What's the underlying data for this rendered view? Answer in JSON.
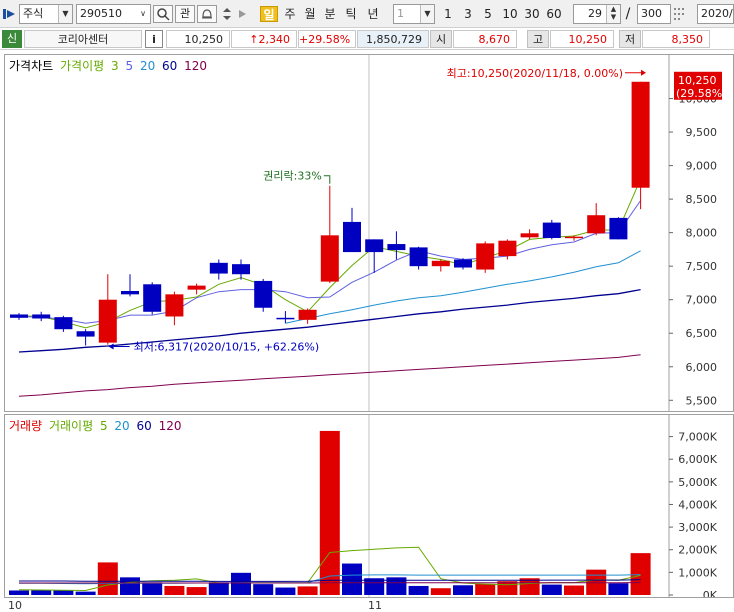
{
  "toolbar": {
    "menu_icon": "menu-arrow-icon",
    "market_type": "주식",
    "stock_code": "290510",
    "search_icon": "magnifier-icon",
    "watch_label": "관",
    "period_buttons": [
      {
        "label": "일",
        "selected": true
      },
      {
        "label": "주",
        "selected": false
      },
      {
        "label": "월",
        "selected": false
      },
      {
        "label": "분",
        "selected": false
      },
      {
        "label": "틱",
        "selected": false
      },
      {
        "label": "년",
        "selected": false
      }
    ],
    "interval_value": "1",
    "interval_buttons": [
      "1",
      "3",
      "5",
      "10",
      "30",
      "60"
    ],
    "view_count": "29",
    "total_count": "300",
    "date_field": "2020/"
  },
  "quote": {
    "badge": "신",
    "name": "코리아센터",
    "info_button": "i",
    "price": "10,250",
    "change": "↑2,340",
    "change_rate": "+29.58%",
    "volume": "1,850,729",
    "open_label": "시",
    "open": "8,670",
    "high_label": "고",
    "high": "10,250",
    "low_label": "저",
    "low": "8,350"
  },
  "colors": {
    "up": "#e00000",
    "down": "#0000c0",
    "ma3": "#66aa00",
    "ma5": "#6060e0",
    "ma20": "#2090d0",
    "ma60": "#000090",
    "ma120": "#800050"
  },
  "price_legend": {
    "title": "가격차트",
    "ma_title": "가격이평",
    "ma_periods": [
      "3",
      "5",
      "20",
      "60",
      "120"
    ]
  },
  "volume_legend": {
    "title": "거래량",
    "ma_title": "거래이평",
    "ma_periods": [
      "5",
      "20",
      "60",
      "120"
    ]
  },
  "annotations": {
    "high": "최고:10,250(2020/11/18, 0.00%)",
    "low": "최저:6,317(2020/10/15, +62.26%)",
    "rights": "권리락:33%",
    "last_price": "10,250",
    "last_rate": "(29.58%)"
  },
  "chart_data": [
    {
      "type": "candlestick",
      "y_ticks": [
        "10,000",
        "9,500",
        "9,000",
        "8,500",
        "8,000",
        "7,500",
        "7,000",
        "6,500",
        "6,000",
        "5,500"
      ],
      "y_tick_values": [
        10000,
        9500,
        9000,
        8500,
        8000,
        7500,
        7000,
        6500,
        6000,
        5500
      ],
      "ylim": [
        5400,
        10500
      ],
      "x_labels": [
        {
          "label": "10",
          "index": 0
        },
        {
          "label": "11",
          "index": 16
        }
      ],
      "candles": [
        {
          "o": 6780,
          "h": 6800,
          "l": 6700,
          "c": 6730
        },
        {
          "o": 6780,
          "h": 6820,
          "l": 6680,
          "c": 6720
        },
        {
          "o": 6740,
          "h": 6760,
          "l": 6520,
          "c": 6560
        },
        {
          "o": 6530,
          "h": 6560,
          "l": 6317,
          "c": 6450
        },
        {
          "o": 6360,
          "h": 7380,
          "l": 6330,
          "c": 7000
        },
        {
          "o": 7130,
          "h": 7380,
          "l": 7050,
          "c": 7080
        },
        {
          "o": 7230,
          "h": 7260,
          "l": 6780,
          "c": 6820
        },
        {
          "o": 6750,
          "h": 7120,
          "l": 6620,
          "c": 7080
        },
        {
          "o": 7150,
          "h": 7240,
          "l": 7080,
          "c": 7210
        },
        {
          "o": 7550,
          "h": 7600,
          "l": 7300,
          "c": 7390
        },
        {
          "o": 7530,
          "h": 7600,
          "l": 7300,
          "c": 7380
        },
        {
          "o": 7280,
          "h": 7310,
          "l": 6820,
          "c": 6880
        },
        {
          "o": 6730,
          "h": 6830,
          "l": 6650,
          "c": 6720
        },
        {
          "o": 6700,
          "h": 6870,
          "l": 6640,
          "c": 6850
        },
        {
          "o": 7270,
          "h": 8700,
          "l": 7250,
          "c": 7960
        },
        {
          "o": 8160,
          "h": 8370,
          "l": 7720,
          "c": 7710
        },
        {
          "o": 7900,
          "h": 7900,
          "l": 7400,
          "c": 7710
        },
        {
          "o": 7830,
          "h": 8020,
          "l": 7600,
          "c": 7740
        },
        {
          "o": 7780,
          "h": 7790,
          "l": 7450,
          "c": 7500
        },
        {
          "o": 7500,
          "h": 7600,
          "l": 7420,
          "c": 7580
        },
        {
          "o": 7600,
          "h": 7620,
          "l": 7450,
          "c": 7480
        },
        {
          "o": 7450,
          "h": 7870,
          "l": 7400,
          "c": 7840
        },
        {
          "o": 7650,
          "h": 7900,
          "l": 7600,
          "c": 7880
        },
        {
          "o": 7930,
          "h": 8050,
          "l": 7900,
          "c": 7990
        },
        {
          "o": 8150,
          "h": 8190,
          "l": 7900,
          "c": 7920
        },
        {
          "o": 7920,
          "h": 7960,
          "l": 7880,
          "c": 7940
        },
        {
          "o": 7990,
          "h": 8440,
          "l": 7960,
          "c": 8260
        },
        {
          "o": 8220,
          "h": 8230,
          "l": 7900,
          "c": 7900
        },
        {
          "o": 8670,
          "h": 10250,
          "l": 8350,
          "c": 10250
        }
      ],
      "ma_lines": [
        {
          "name": "3",
          "values": [
            6760,
            6750,
            6670,
            6580,
            6670,
            6840,
            6970,
            6990,
            7040,
            7230,
            7330,
            7220,
            7000,
            6820,
            7180,
            7510,
            7790,
            7720,
            7650,
            7600,
            7520,
            7630,
            7730,
            7900,
            7930,
            7950,
            8040,
            8040,
            8800
          ]
        },
        {
          "name": "5",
          "values": [
            6750,
            6740,
            6710,
            6650,
            6690,
            6770,
            6770,
            6830,
            7030,
            7120,
            7150,
            7150,
            7120,
            7030,
            7040,
            7260,
            7410,
            7590,
            7730,
            7650,
            7600,
            7620,
            7650,
            7750,
            7820,
            7860,
            7990,
            8000,
            8480
          ]
        },
        {
          "name": "20",
          "values": [
            null,
            null,
            null,
            null,
            null,
            null,
            null,
            null,
            null,
            null,
            null,
            null,
            6650,
            6720,
            6790,
            6850,
            6920,
            6980,
            7030,
            7060,
            7110,
            7170,
            7230,
            7280,
            7340,
            7410,
            7490,
            7550,
            7730
          ]
        },
        {
          "name": "60",
          "values": [
            6220,
            6240,
            6260,
            6290,
            6310,
            6340,
            6370,
            6400,
            6430,
            6460,
            6500,
            6530,
            6560,
            6590,
            6630,
            6670,
            6710,
            6750,
            6790,
            6820,
            6860,
            6890,
            6920,
            6960,
            6990,
            7020,
            7060,
            7090,
            7150
          ]
        },
        {
          "name": "120",
          "values": [
            5560,
            5580,
            5610,
            5640,
            5660,
            5690,
            5710,
            5740,
            5760,
            5780,
            5800,
            5820,
            5840,
            5860,
            5880,
            5900,
            5920,
            5940,
            5960,
            5980,
            6000,
            6020,
            6040,
            6060,
            6080,
            6100,
            6120,
            6140,
            6180
          ]
        }
      ]
    },
    {
      "type": "bar",
      "y_ticks": [
        "7,000K",
        "6,000K",
        "5,000K",
        "4,000K",
        "3,000K",
        "2,000K",
        "1,000K",
        "0K"
      ],
      "y_tick_values": [
        7000000,
        6000000,
        5000000,
        4000000,
        3000000,
        2000000,
        1000000,
        0
      ],
      "ylim": [
        0,
        7600000
      ],
      "values": [
        200000,
        210000,
        200000,
        150000,
        1440000,
        780000,
        560000,
        400000,
        350000,
        560000,
        980000,
        480000,
        330000,
        380000,
        7250000,
        1390000,
        740000,
        780000,
        400000,
        300000,
        430000,
        490000,
        610000,
        740000,
        460000,
        420000,
        1120000,
        520000,
        1850000
      ],
      "ma_lines": [
        {
          "name": "5",
          "values": [
            230000,
            220000,
            210000,
            200000,
            440000,
            560000,
            630000,
            650000,
            710000,
            530000,
            530000,
            550000,
            540000,
            540000,
            1880000,
            1960000,
            2020000,
            2080000,
            2110000,
            720000,
            530000,
            480000,
            450000,
            510000,
            550000,
            550000,
            670000,
            650000,
            870000
          ]
        },
        {
          "name": "20",
          "values": [
            520000,
            520000,
            510000,
            500000,
            510000,
            520000,
            520000,
            520000,
            530000,
            530000,
            540000,
            540000,
            540000,
            540000,
            840000,
            880000,
            890000,
            890000,
            880000,
            880000,
            880000,
            880000,
            880000,
            880000,
            880000,
            880000,
            880000,
            880000,
            900000
          ]
        },
        {
          "name": "60",
          "values": [
            620000,
            620000,
            620000,
            610000,
            610000,
            610000,
            610000,
            610000,
            610000,
            600000,
            600000,
            600000,
            600000,
            610000,
            650000,
            650000,
            650000,
            650000,
            650000,
            650000,
            650000,
            650000,
            650000,
            650000,
            660000,
            660000,
            660000,
            660000,
            680000
          ]
        },
        {
          "name": "120",
          "values": [
            530000,
            530000,
            530000,
            530000,
            530000,
            530000,
            530000,
            530000,
            530000,
            530000,
            530000,
            530000,
            530000,
            530000,
            540000,
            540000,
            540000,
            540000,
            540000,
            540000,
            540000,
            540000,
            540000,
            540000,
            540000,
            540000,
            540000,
            540000,
            550000
          ]
        }
      ]
    }
  ]
}
